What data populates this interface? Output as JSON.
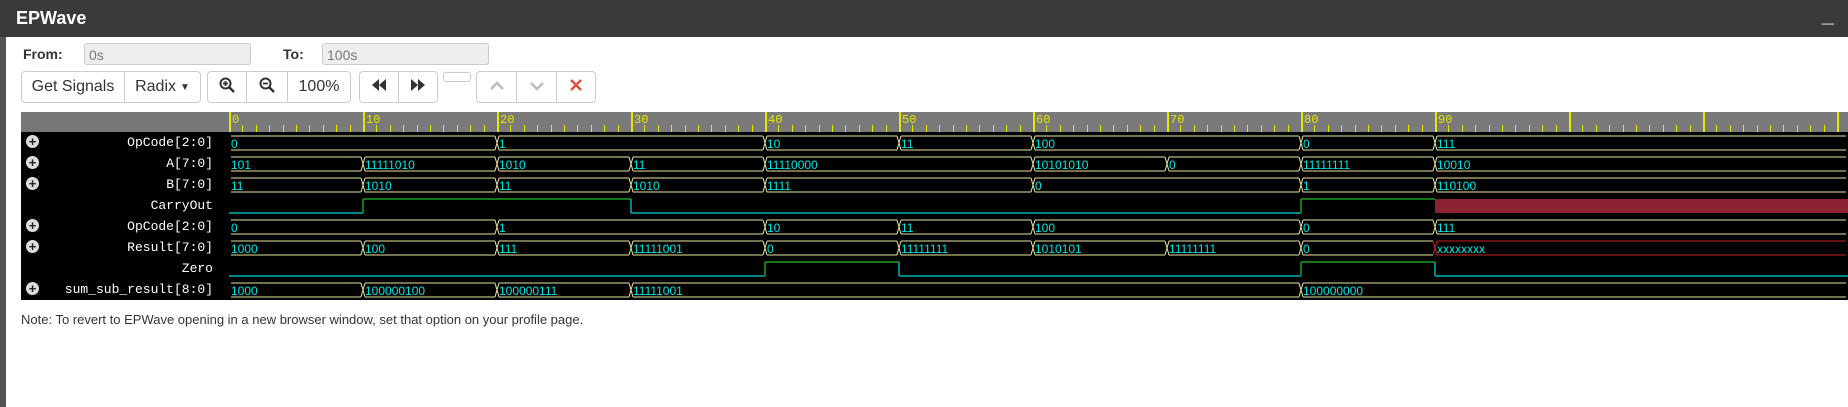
{
  "app": {
    "title": "EPWave",
    "minimize_label": "_"
  },
  "range": {
    "from_label": "From:",
    "from_value": "0s",
    "to_label": "To:",
    "to_value": "100s"
  },
  "toolbar": {
    "get_signals": "Get Signals",
    "radix": "Radix",
    "zoom_level": "100%"
  },
  "colors": {
    "value_text": "#00e5e5",
    "ruler": "#e6e600",
    "bit_high": "#1a9e1a",
    "bit_low": "#00b3b3",
    "unknown": "#8b2332"
  },
  "timeline": {
    "start": 0,
    "end": 100,
    "labels": [
      "0",
      "10",
      "20",
      "30",
      "40",
      "50",
      "60",
      "70",
      "80",
      "90"
    ]
  },
  "signals": [
    {
      "name": "OpCode[2:0]",
      "expandable": true,
      "type": "bus",
      "segments": [
        {
          "t": 0,
          "v": "0"
        },
        {
          "t": 20,
          "v": "1"
        },
        {
          "t": 40,
          "v": "10"
        },
        {
          "t": 50,
          "v": "11"
        },
        {
          "t": 60,
          "v": "100"
        },
        {
          "t": 80,
          "v": "0"
        },
        {
          "t": 90,
          "v": "111"
        }
      ]
    },
    {
      "name": "A[7:0]",
      "expandable": true,
      "type": "bus",
      "segments": [
        {
          "t": 0,
          "v": "101"
        },
        {
          "t": 10,
          "v": "11111010"
        },
        {
          "t": 20,
          "v": "1010"
        },
        {
          "t": 30,
          "v": "11"
        },
        {
          "t": 40,
          "v": "11110000"
        },
        {
          "t": 60,
          "v": "10101010"
        },
        {
          "t": 70,
          "v": "0"
        },
        {
          "t": 80,
          "v": "11111111"
        },
        {
          "t": 90,
          "v": "10010"
        }
      ]
    },
    {
      "name": "B[7:0]",
      "expandable": true,
      "type": "bus",
      "segments": [
        {
          "t": 0,
          "v": "11"
        },
        {
          "t": 10,
          "v": "1010"
        },
        {
          "t": 20,
          "v": "11"
        },
        {
          "t": 30,
          "v": "1010"
        },
        {
          "t": 40,
          "v": "1111"
        },
        {
          "t": 60,
          "v": "0"
        },
        {
          "t": 80,
          "v": "1"
        },
        {
          "t": 90,
          "v": "110100"
        }
      ]
    },
    {
      "name": "CarryOut",
      "expandable": false,
      "type": "bit",
      "segments": [
        {
          "t": 0,
          "v": "0"
        },
        {
          "t": 10,
          "v": "1"
        },
        {
          "t": 30,
          "v": "0"
        },
        {
          "t": 80,
          "v": "1"
        },
        {
          "t": 90,
          "v": "x"
        }
      ]
    },
    {
      "name": "OpCode[2:0]",
      "expandable": true,
      "type": "bus",
      "segments": [
        {
          "t": 0,
          "v": "0"
        },
        {
          "t": 20,
          "v": "1"
        },
        {
          "t": 40,
          "v": "10"
        },
        {
          "t": 50,
          "v": "11"
        },
        {
          "t": 60,
          "v": "100"
        },
        {
          "t": 80,
          "v": "0"
        },
        {
          "t": 90,
          "v": "111"
        }
      ]
    },
    {
      "name": "Result[7:0]",
      "expandable": true,
      "type": "bus",
      "segments": [
        {
          "t": 0,
          "v": "1000"
        },
        {
          "t": 10,
          "v": "100"
        },
        {
          "t": 20,
          "v": "111"
        },
        {
          "t": 30,
          "v": "11111001"
        },
        {
          "t": 40,
          "v": "0"
        },
        {
          "t": 50,
          "v": "11111111"
        },
        {
          "t": 60,
          "v": "1010101"
        },
        {
          "t": 70,
          "v": "11111111"
        },
        {
          "t": 80,
          "v": "0"
        },
        {
          "t": 90,
          "v": "xxxxxxxx"
        }
      ]
    },
    {
      "name": "Zero",
      "expandable": false,
      "type": "bit",
      "segments": [
        {
          "t": 0,
          "v": "0"
        },
        {
          "t": 40,
          "v": "1"
        },
        {
          "t": 50,
          "v": "0"
        },
        {
          "t": 80,
          "v": "1"
        },
        {
          "t": 90,
          "v": "0"
        }
      ]
    },
    {
      "name": "sum_sub_result[8:0]",
      "expandable": true,
      "type": "bus",
      "segments": [
        {
          "t": 0,
          "v": "1000"
        },
        {
          "t": 10,
          "v": "100000100"
        },
        {
          "t": 20,
          "v": "100000111"
        },
        {
          "t": 30,
          "v": "11111001"
        },
        {
          "t": 80,
          "v": "100000000"
        }
      ]
    }
  ],
  "note": "Note: To revert to EPWave opening in a new browser window, set that option on your profile page."
}
